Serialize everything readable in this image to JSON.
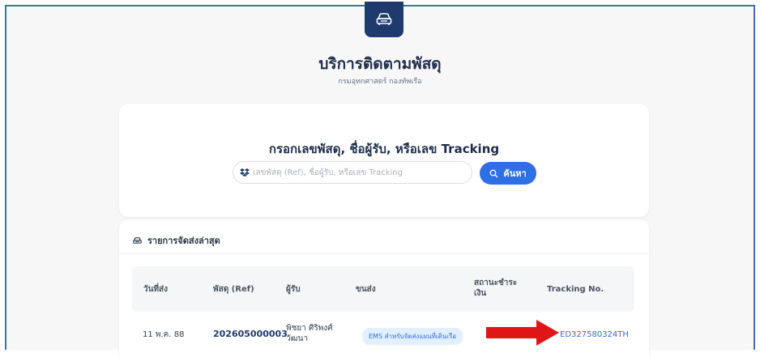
{
  "header": {
    "title": "บริการติดตามพัสดุ",
    "subtitle": "กรมอุทกศาสตร์ กองทัพเรือ"
  },
  "search": {
    "heading": "กรอกเลขพัสดุ, ชื่อผู้รับ, หรือเลข Tracking",
    "placeholder": "เลขพัสดุ (Ref), ชื่อผู้รับ, หรือเลข Tracking",
    "button_label": "ค้นหา"
  },
  "recent": {
    "heading": "รายการจัดส่งล่าสุด",
    "columns": {
      "date": "วันที่ส่ง",
      "ref": "พัสดุ (Ref)",
      "recipient": "ผู้รับ",
      "shipping": "ขนส่ง",
      "payment_line1": "สถานะชำระ",
      "payment_line2": "เงิน",
      "tracking": "Tracking No."
    },
    "rows": [
      {
        "date": "11 พ.ค. 88",
        "ref": "202605000003",
        "recipient_line1": "พิชยา ศิริพงศ์",
        "recipient_line2": "วัฒนา",
        "shipping": "EMS สำหรับจัดส่งแผนที่เดินเรือ",
        "tracking": "ED327580324TH"
      }
    ]
  },
  "colors": {
    "brand_dark": "#1f3b6e",
    "accent": "#2f6fe4",
    "annotation_arrow": "#e01515"
  },
  "icons": {
    "logo": "car-icon",
    "search_field": "dropbox-icon",
    "search_button": "search-icon",
    "recent_heading": "car-icon"
  }
}
